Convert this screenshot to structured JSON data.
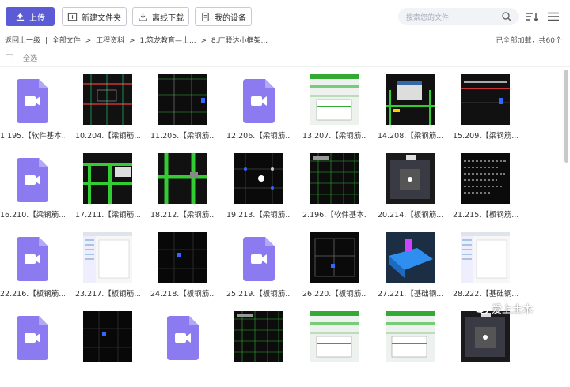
{
  "toolbar": {
    "upload": "上传",
    "new_folder": "新建文件夹",
    "offline_download": "离线下载",
    "my_devices": "我的设备",
    "search_placeholder": "搜索您的文件"
  },
  "breadcrumb": {
    "back": "返回上一级",
    "separator_bar": "|",
    "items": [
      "全部文件",
      "工程资料",
      "1.筑龙教育—土...",
      "8.广联达小框架..."
    ],
    "separator": ">"
  },
  "status_text": "已全部加载，共60个",
  "select_all": "全选",
  "files": [
    {
      "name": "1.195.【软件基本...",
      "type": "video"
    },
    {
      "name": "10.204.【梁钢筋...",
      "type": "image",
      "style": "cad-red"
    },
    {
      "name": "11.205.【梁钢筋...",
      "type": "image",
      "style": "cad-blue"
    },
    {
      "name": "12.206.【梁钢筋...",
      "type": "video"
    },
    {
      "name": "13.207.【梁钢筋...",
      "type": "image",
      "style": "table-green"
    },
    {
      "name": "14.208.【梁钢筋...",
      "type": "image",
      "style": "cad-dialog"
    },
    {
      "name": "15.209.【梁钢筋...",
      "type": "image",
      "style": "cad-redline"
    },
    {
      "name": "16.210.【梁钢筋...",
      "type": "video"
    },
    {
      "name": "17.211.【梁钢筋...",
      "type": "image",
      "style": "cad-green"
    },
    {
      "name": "18.212.【梁钢筋...",
      "type": "image",
      "style": "cad-green2"
    },
    {
      "name": "19.213.【梁钢筋...",
      "type": "image",
      "style": "cad-dots"
    },
    {
      "name": "2.196.【软件基本...",
      "type": "image",
      "style": "cad-grid"
    },
    {
      "name": "20.214.【板钢筋...",
      "type": "image",
      "style": "cad-gray"
    },
    {
      "name": "21.215.【板钢筋...",
      "type": "image",
      "style": "cad-text"
    },
    {
      "name": "22.216.【板钢筋...",
      "type": "video"
    },
    {
      "name": "23.217.【板钢筋...",
      "type": "image",
      "style": "ui-light"
    },
    {
      "name": "24.218.【板钢筋...",
      "type": "image",
      "style": "cad-dark"
    },
    {
      "name": "25.219.【板钢筋...",
      "type": "video"
    },
    {
      "name": "26.220.【板钢筋...",
      "type": "image",
      "style": "cad-lines"
    },
    {
      "name": "27.221.【基础钢...",
      "type": "image",
      "style": "model-3d"
    },
    {
      "name": "28.222.【基础钢...",
      "type": "image",
      "style": "ui-light"
    },
    {
      "name": "",
      "type": "video"
    },
    {
      "name": "",
      "type": "image",
      "style": "cad-dark"
    },
    {
      "name": "",
      "type": "video"
    },
    {
      "name": "",
      "type": "image",
      "style": "cad-grid"
    },
    {
      "name": "",
      "type": "image",
      "style": "table-green"
    },
    {
      "name": "",
      "type": "image",
      "style": "table-green"
    },
    {
      "name": "",
      "type": "image",
      "style": "cad-gray"
    }
  ],
  "watermark": "爱上土木",
  "colors": {
    "accent": "#5b5bd6",
    "video_tile": "#8c7bf0"
  }
}
